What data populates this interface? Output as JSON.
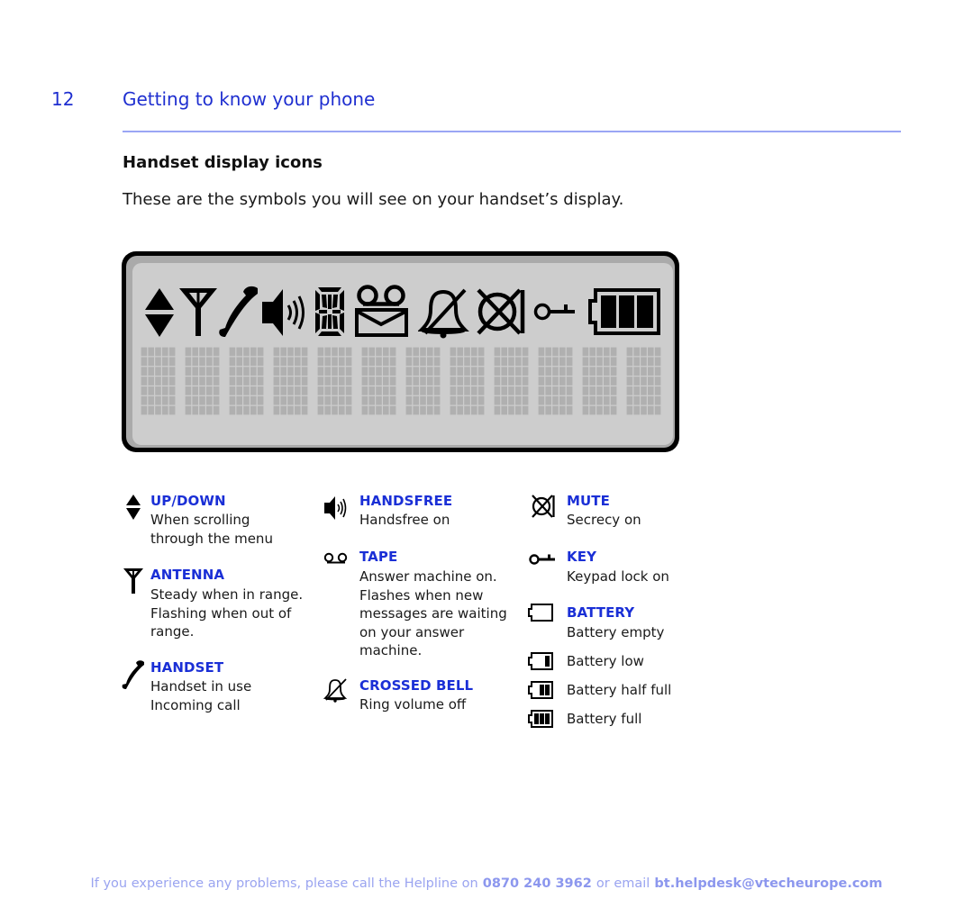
{
  "header": {
    "page_number": "12",
    "section_title": "Getting to know your phone"
  },
  "content": {
    "subheading": "Handset display icons",
    "intro": "These are the symbols you will see on your handset’s display."
  },
  "display": {
    "icons": [
      "up-down-icon",
      "antenna-icon",
      "handset-icon",
      "handsfree-icon",
      "segment-digit-icon",
      "tape-envelope-icon",
      "crossed-bell-icon",
      "mute-icon",
      "key-icon",
      "battery-full-icon"
    ],
    "character_cells": 12,
    "cell_columns": 5,
    "cell_rows": 7
  },
  "legend": {
    "up_down": {
      "title": "UP/DOWN",
      "lines": [
        "When scrolling",
        "through the menu"
      ]
    },
    "antenna": {
      "title": "ANTENNA",
      "lines": [
        "Steady when in range.",
        "Flashing when out of",
        "range."
      ]
    },
    "handset": {
      "title": "HANDSET",
      "lines": [
        "Handset in use",
        "Incoming call"
      ]
    },
    "handsfree": {
      "title": "HANDSFREE",
      "lines": [
        "Handsfree on"
      ]
    },
    "tape": {
      "title": "TAPE",
      "lines": [
        "Answer machine on.",
        "Flashes when new",
        "messages are waiting",
        "on your answer",
        "machine."
      ]
    },
    "crossed_bell": {
      "title": "CROSSED BELL",
      "lines": [
        "Ring volume off"
      ]
    },
    "mute": {
      "title": "MUTE",
      "lines": [
        "Secrecy on"
      ]
    },
    "key": {
      "title": "KEY",
      "lines": [
        "Keypad lock on"
      ]
    },
    "battery": {
      "title": "BATTERY",
      "states": [
        {
          "label": "Battery empty",
          "bars": 0
        },
        {
          "label": "Battery low",
          "bars": 1
        },
        {
          "label": "Battery half full",
          "bars": 2
        },
        {
          "label": "Battery full",
          "bars": 3
        }
      ]
    }
  },
  "footer": {
    "prefix": "If you experience any problems, please call the Helpline on",
    "phone": "0870 240 3962",
    "middle": "or email",
    "email": "bt.helpdesk@vtecheurope.com"
  },
  "colors": {
    "accent_blue": "#1a2fd6",
    "divider": "#9aa6f4",
    "footer": "#9aa4f0",
    "lcd_background": "#cdcdcd",
    "lcd_ring": "#aaaaaa",
    "lcd_dots": "#b0b0b0"
  }
}
